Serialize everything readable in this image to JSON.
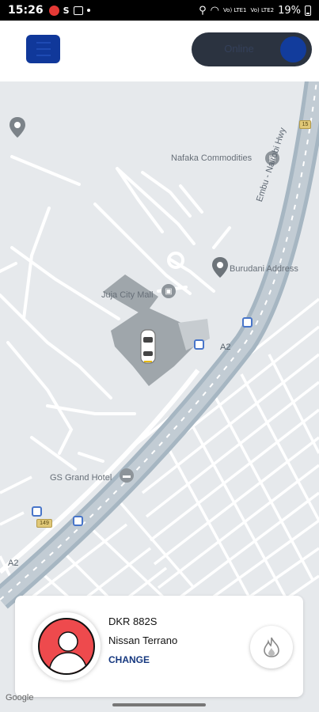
{
  "status_bar": {
    "time": "15:26",
    "battery": "19%",
    "signal1": "Vo) LTE1",
    "signal2": "Vo) LTE2"
  },
  "header": {
    "toggle_label": "Online"
  },
  "map": {
    "labels": {
      "nafaka": "Nafaka Commodities",
      "burudani": "Burudani Address",
      "jujucity": "Juja City Mall",
      "gsgrand": "GS Grand Hotel",
      "highway": "Embu - Nairobi Hwy",
      "a2_a": "A2",
      "a2_b": "A2",
      "route1": "15",
      "route2": "149"
    },
    "attribution": "Google"
  },
  "vehicle": {
    "plate": "DKR 882S",
    "model": "Nissan Terrano",
    "change_label": "CHANGE"
  },
  "colors": {
    "primary": "#10389a",
    "avatar_bg": "#ee4a4d",
    "toggle_bg": "#2b3340"
  }
}
